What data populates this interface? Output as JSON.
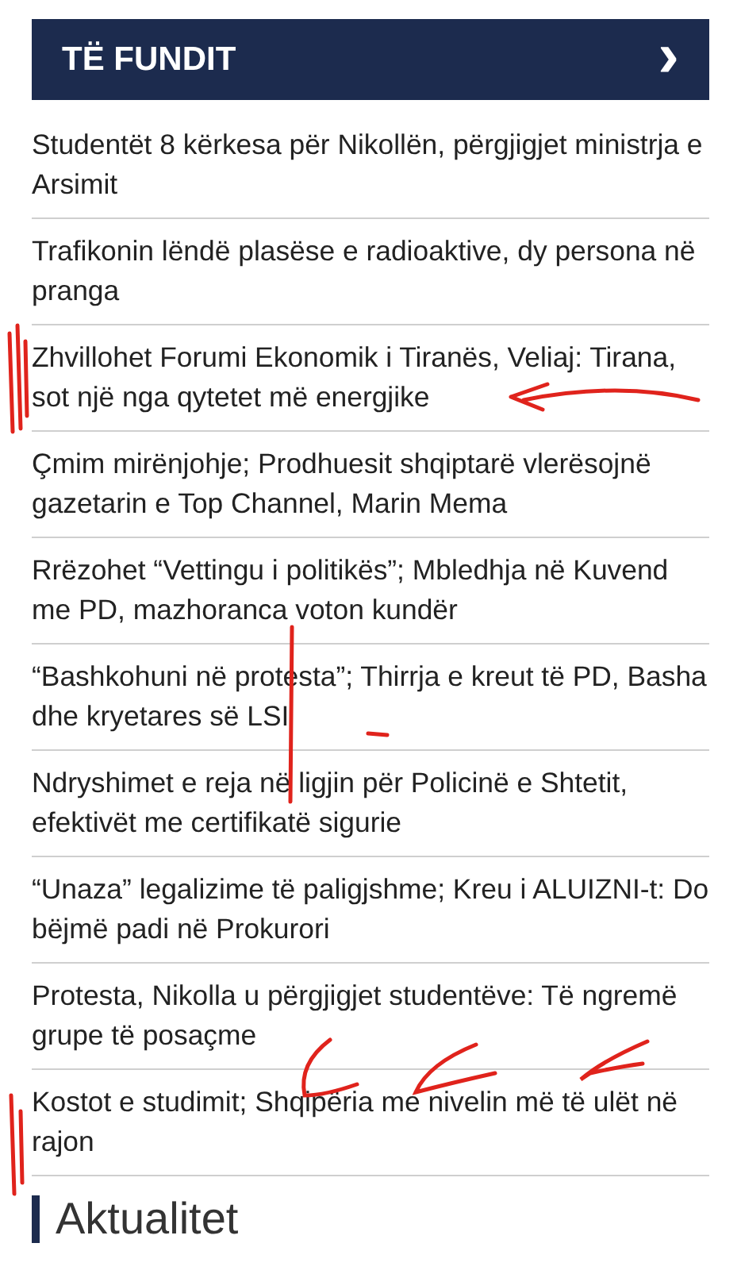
{
  "header": {
    "title": "TË FUNDIT",
    "arrow": "›"
  },
  "articles": [
    {
      "title": "Studentët 8 kërkesa për Nikollën, përgjigjet ministrja e Arsimit"
    },
    {
      "title": "Trafikonin lëndë plasëse e radioaktive, dy persona në pranga"
    },
    {
      "title": "Zhvillohet Forumi Ekonomik i Tiranës, Veliaj: Tirana, sot një nga qytetet më energjike"
    },
    {
      "title": "Çmim mirënjohje; Prodhuesit shqiptarë vlerësojnë gazetarin e Top Channel, Marin Mema"
    },
    {
      "title": "Rrëzohet “Vettingu i politikës”; Mbledhja në Kuvend me PD, mazhoranca voton kundër"
    },
    {
      "title": "“Bashkohuni në protesta”; Thirrja e kreut të PD, Basha dhe kryetares së LSI"
    },
    {
      "title": "Ndryshimet e reja në ligjin për Policinë e Shtetit, efektivët me certifikatë sigurie"
    },
    {
      "title": "“Unaza” legalizime të paligjshme; Kreu i ALUIZNI-t: Do bëjmë padi në Prokurori"
    },
    {
      "title": "Protesta, Nikolla u përgjigjet studentëve: Të ngremë grupe të posaçme"
    },
    {
      "title": "Kostot e studimit; Shqipëria me nivelin më të ulët në rajon"
    }
  ],
  "section": {
    "title": "Aktualitet"
  }
}
